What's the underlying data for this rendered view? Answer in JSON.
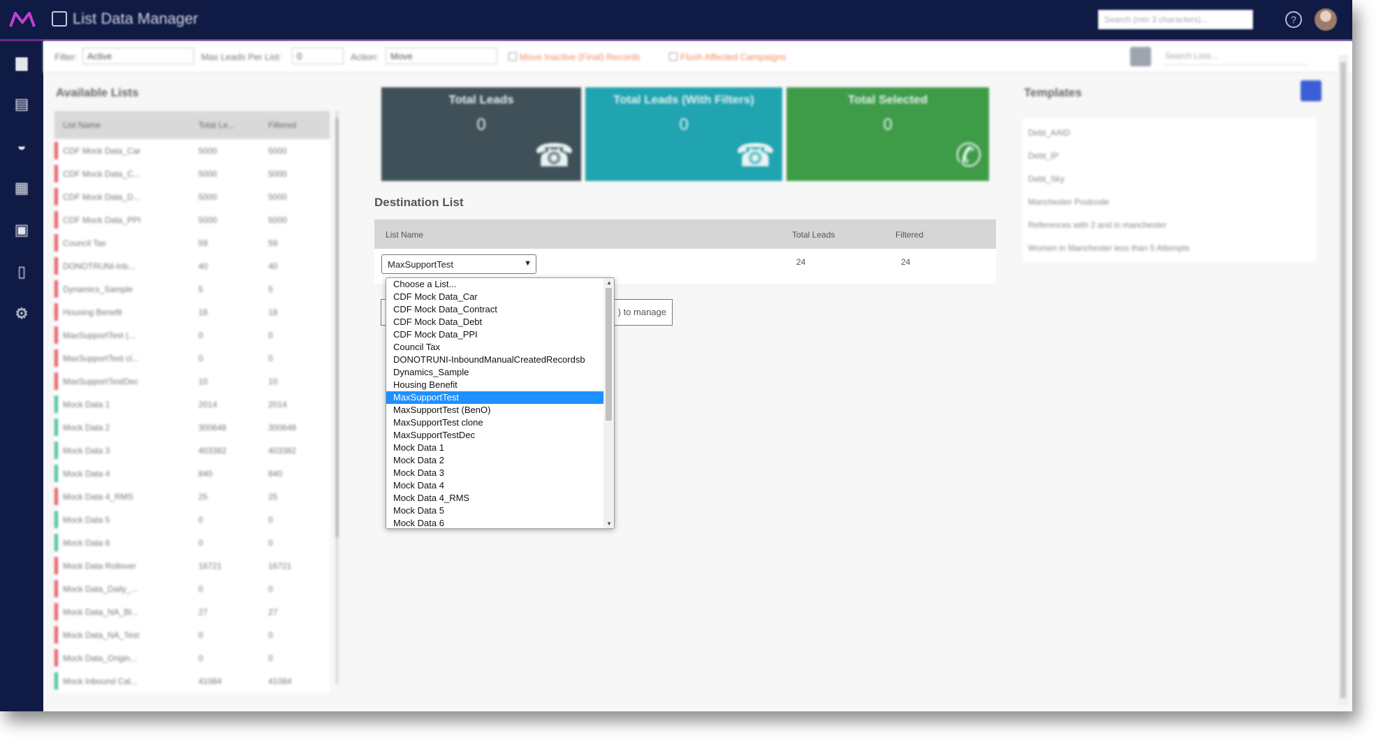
{
  "header": {
    "title": "List Data Manager",
    "search_placeholder": "Search (min 3 characters)...",
    "help_glyph": "?"
  },
  "sidebar": {
    "icons": [
      "briefcase-icon",
      "grid-icon",
      "dashboard-icon",
      "database-icon",
      "contacts-icon",
      "document-icon",
      "settings-icon"
    ]
  },
  "toolbar": {
    "filter_label": "Filter:",
    "filter_value": "Active",
    "max_leads_label": "Max Leads Per List:",
    "max_leads_value": "0",
    "action_label": "Action:",
    "action_value": "Move",
    "check1_label": "Move Inactive (Final) Records",
    "check2_label": "Flush Affected Campaigns",
    "search_placeholder": "Search Lists..."
  },
  "available": {
    "title": "Available Lists",
    "headers": [
      "List Name",
      "Total Le...",
      "Filtered"
    ],
    "rows": [
      {
        "name": "CDF Mock Data_Car",
        "total": "5000",
        "filtered": "5000",
        "color": "#e8646b"
      },
      {
        "name": "CDF Mock Data_C...",
        "total": "5000",
        "filtered": "5000",
        "color": "#e8646b"
      },
      {
        "name": "CDF Mock Data_D...",
        "total": "5000",
        "filtered": "5000",
        "color": "#e8646b"
      },
      {
        "name": "CDF Mock Data_PPI",
        "total": "5000",
        "filtered": "5000",
        "color": "#e8646b"
      },
      {
        "name": "Council Tax",
        "total": "59",
        "filtered": "59",
        "color": "#e8646b"
      },
      {
        "name": "DONOTRUNI-Inb...",
        "total": "40",
        "filtered": "40",
        "color": "#e8646b"
      },
      {
        "name": "Dynamics_Sample",
        "total": "5",
        "filtered": "5",
        "color": "#e8646b"
      },
      {
        "name": "Housing Benefit",
        "total": "18",
        "filtered": "18",
        "color": "#e8646b"
      },
      {
        "name": "MaxSupportTest (...",
        "total": "0",
        "filtered": "0",
        "color": "#e8646b"
      },
      {
        "name": "MaxSupportTest cl...",
        "total": "0",
        "filtered": "0",
        "color": "#e8646b"
      },
      {
        "name": "MaxSupportTestDec",
        "total": "10",
        "filtered": "10",
        "color": "#e8646b"
      },
      {
        "name": "Mock Data 1",
        "total": "2014",
        "filtered": "2014",
        "color": "#4fc3a1"
      },
      {
        "name": "Mock Data 2",
        "total": "300648",
        "filtered": "300648",
        "color": "#4fc3a1"
      },
      {
        "name": "Mock Data 3",
        "total": "403382",
        "filtered": "403382",
        "color": "#4fc3a1"
      },
      {
        "name": "Mock Data 4",
        "total": "840",
        "filtered": "840",
        "color": "#4fc3a1"
      },
      {
        "name": "Mock Data 4_RMS",
        "total": "25",
        "filtered": "25",
        "color": "#e8646b"
      },
      {
        "name": "Mock Data 5",
        "total": "0",
        "filtered": "0",
        "color": "#4fc3a1"
      },
      {
        "name": "Mock Data 6",
        "total": "0",
        "filtered": "0",
        "color": "#4fc3a1"
      },
      {
        "name": "Mock Data Rollover",
        "total": "16721",
        "filtered": "16721",
        "color": "#e8646b"
      },
      {
        "name": "Mock Data_Daily_...",
        "total": "0",
        "filtered": "0",
        "color": "#e8646b"
      },
      {
        "name": "Mock Data_NA_Bl...",
        "total": "27",
        "filtered": "27",
        "color": "#e8646b"
      },
      {
        "name": "Mock Data_NA_Test",
        "total": "0",
        "filtered": "0",
        "color": "#e8646b"
      },
      {
        "name": "Mock Data_Origin...",
        "total": "0",
        "filtered": "0",
        "color": "#e8646b"
      },
      {
        "name": "Mock Inbound Cal...",
        "total": "41084",
        "filtered": "41084",
        "color": "#4fc3a1"
      }
    ]
  },
  "tiles": [
    {
      "title": "Total Leads",
      "value": "0",
      "color": "#3f5058",
      "icon": "☎"
    },
    {
      "title": "Total Leads (With Filters)",
      "value": "0",
      "color": "#1fa4b0",
      "icon": "☎"
    },
    {
      "title": "Total Selected",
      "value": "0",
      "color": "#3e9c48",
      "icon": "✆"
    }
  ],
  "templates": {
    "title": "Templates",
    "items": [
      "Debt_AAID",
      "Debt_IP",
      "Debt_Sky",
      "Manchester Postcode",
      "References with 2 and in manchester",
      "Women in Manchester less than 5 Attempts"
    ]
  },
  "destination": {
    "title": "Destination List",
    "headers": {
      "name": "List Name",
      "total": "Total Leads",
      "filtered": "Filtered"
    },
    "selected": "MaxSupportTest",
    "total": "24",
    "filtered": "24",
    "manage_label": ") to manage",
    "options": [
      "Choose a List...",
      "CDF Mock Data_Car",
      "CDF Mock Data_Contract",
      "CDF Mock Data_Debt",
      "CDF Mock Data_PPI",
      "Council Tax",
      "DONOTRUNI-InboundManualCreatedRecordsb",
      "Dynamics_Sample",
      "Housing Benefit",
      "MaxSupportTest",
      "MaxSupportTest (BenO)",
      "MaxSupportTest clone",
      "MaxSupportTestDec",
      "Mock Data 1",
      "Mock Data 2",
      "Mock Data 3",
      "Mock Data 4",
      "Mock Data 4_RMS",
      "Mock Data 5",
      "Mock Data 6"
    ],
    "selected_index": 9
  }
}
